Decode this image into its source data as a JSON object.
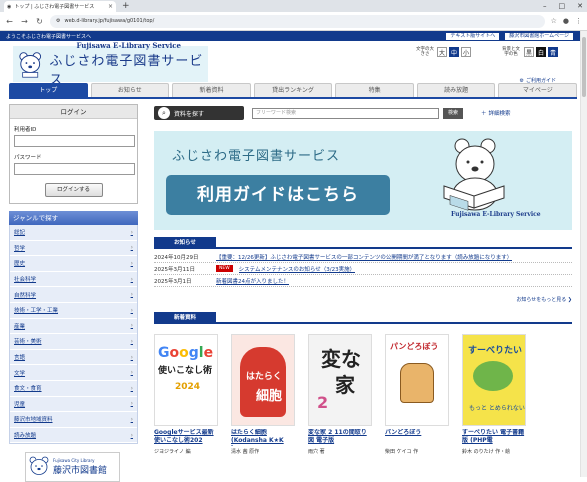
{
  "browser": {
    "tab_title": "トップ | ふじさわ電子図書サービス",
    "url": "web.d-library.jp/fujisawa/g0101/top/"
  },
  "topbar": {
    "welcome": "ようこそふじさわ電子図書サービスへ",
    "link_text_site": "テキスト版サイトへ",
    "link_city_lib": "藤沢市図書館ホームページ"
  },
  "header": {
    "logo_en": "Fujisawa E-Library Service",
    "logo_jp": "ふじさわ電子図書サービス",
    "font_size_label": "文字の大きさ",
    "font_large": "大",
    "font_medium": "中",
    "font_small": "小",
    "color_label": "背景と文字の色",
    "color_white": "黒",
    "color_black": "白",
    "color_blue": "青",
    "contact": "ご利用ガイド"
  },
  "nav": {
    "tabs": [
      "トップ",
      "お知らせ",
      "新着資料",
      "貸出ランキング",
      "特集",
      "読み放題",
      "マイページ"
    ]
  },
  "login": {
    "heading": "ログイン",
    "user_id_label": "利用者ID",
    "password_label": "パスワード",
    "button": "ログインする"
  },
  "genre": {
    "heading": "ジャンルで探す",
    "items": [
      "総記",
      "哲学",
      "歴史",
      "社会科学",
      "自然科学",
      "技術・工学・工業",
      "産業",
      "芸術・美術",
      "言語",
      "文学",
      "食文・食育",
      "児童",
      "藤沢市地域資料",
      "読み放題"
    ]
  },
  "city_library": {
    "small": "Fujisawa City Library",
    "name": "藤沢市図書館"
  },
  "search": {
    "button": "資料を探す",
    "placeholder": "フリーワード検索",
    "go": "検索",
    "advanced": "詳細検索"
  },
  "banner": {
    "title": "ふじさわ電子図書サービス",
    "guide": "利用ガイドはこちら",
    "en": "Fujisawa E-Library Service"
  },
  "news": {
    "heading": "お知らせ",
    "items": [
      {
        "date": "2024年10月29日",
        "new": "",
        "text": "【重要：12/26更新】ふじさわ電子図書サービスの一部コンテンツの公開期間が満了となります（読み放題になります）"
      },
      {
        "date": "2025年3月11日",
        "new": "NEW",
        "text": "システムメンテナンスのお知らせ（3/23実施）"
      },
      {
        "date": "2025年3月1日",
        "new": "",
        "text": "新着図書24点が入りました！"
      }
    ],
    "more": "お知らせをもっと見る"
  },
  "new_arrivals": {
    "heading": "新着資料",
    "books": [
      {
        "title": "Googleサービス最新 使いこなし術202",
        "author": "ジヨジライノ 編",
        "cover_text": "Google 最新 使いこなし術 2024"
      },
      {
        "title": "はたらく細胞 (Kodansha K★K bun",
        "author": "清水 茜 原作",
        "cover_text": "はたらく細胞"
      },
      {
        "title": "変な家 2 11の間取り図 電子版",
        "author": "雨穴 著",
        "cover_text": "変な家 2"
      },
      {
        "title": "パンどろぼう",
        "author": "柴田 ケイコ 作",
        "cover_text": "パンどろぼう"
      },
      {
        "title": "すーべりたい 電子書籍版 (PHP電",
        "author": "鈴木 のりたけ 作・絵",
        "cover_text": "すーべりたい"
      }
    ]
  }
}
